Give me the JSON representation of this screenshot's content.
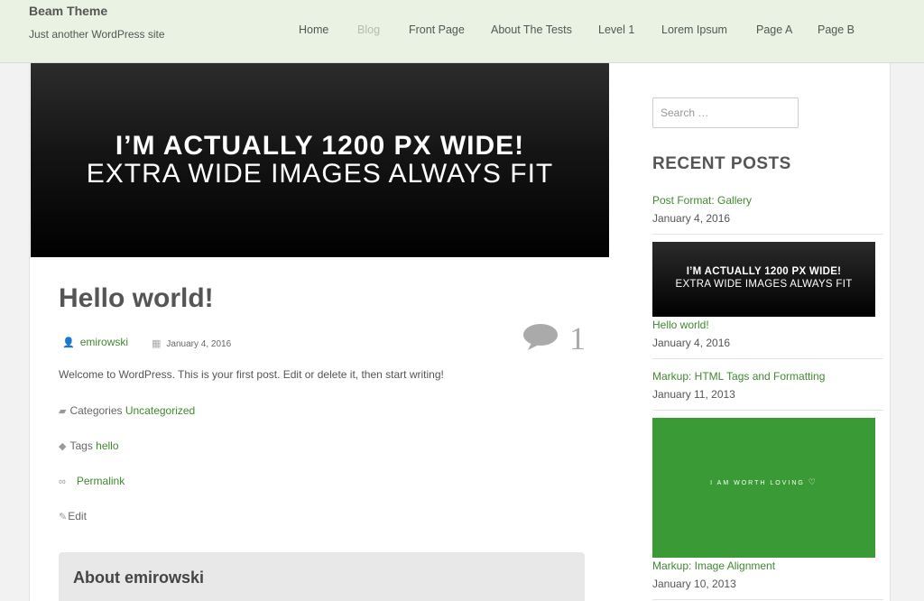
{
  "site": {
    "title": "Beam Theme",
    "description": "Just another WordPress site"
  },
  "nav": [
    {
      "label": "Home",
      "active": false
    },
    {
      "label": "Blog",
      "active": true
    },
    {
      "label": "Front Page",
      "active": false
    },
    {
      "label": "About The Tests",
      "active": false
    },
    {
      "label": "Level 1",
      "active": false
    },
    {
      "label": "Lorem Ipsum",
      "active": false
    },
    {
      "label": "Page A",
      "active": false
    },
    {
      "label": "Page B",
      "active": false
    }
  ],
  "featured_image": {
    "line1": "I’M ACTUALLY 1200 PX WIDE!",
    "line2": "EXTRA WIDE IMAGES ALWAYS FIT"
  },
  "post": {
    "title": "Hello world!",
    "author": "emirowski",
    "date": "January 4, 2016",
    "comment_count": "1",
    "body": "Welcome to WordPress. This is your first post. Edit or delete it, then start writing!",
    "categories_label": "Categories",
    "category": "Uncategorized",
    "tags_label": "Tags",
    "tag": "hello",
    "permalink": "Permalink",
    "edit": "Edit",
    "about_title": "About emirowski"
  },
  "sidebar": {
    "search_placeholder": "Search …",
    "recent_heading": "RECENT POSTS",
    "recent_posts": [
      {
        "title": "Post Format: Gallery",
        "date": "January 4, 2016"
      },
      {
        "title": "Hello world!",
        "date": "January 4, 2016"
      },
      {
        "title": "Markup: HTML Tags and Formatting",
        "date": "January 11, 2013"
      },
      {
        "title": "Markup: Image Alignment",
        "date": "January 10, 2013"
      }
    ],
    "thumb1": {
      "line1": "I’M ACTUALLY 1200 PX WIDE!",
      "line2": "EXTRA WIDE IMAGES ALWAYS FIT"
    },
    "thumb2": {
      "text": "I AM WORTH LOVING"
    }
  },
  "colors": {
    "header_bg": "#e9f2e3",
    "link_green": "#3e8a2e",
    "thumb_green": "#3a9a35"
  }
}
